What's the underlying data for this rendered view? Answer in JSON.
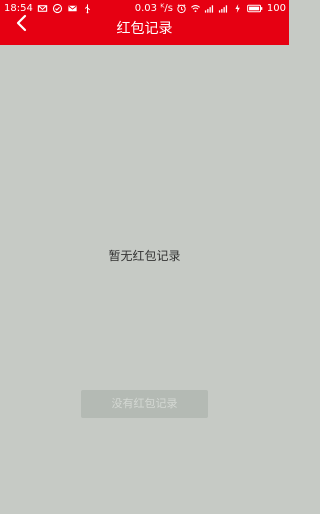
{
  "status_bar": {
    "time": "18:54",
    "network_speed": "0.03 ᴷ/s",
    "battery": "100",
    "icons_left": [
      "mail-icon",
      "check-circle-icon",
      "mail-icon",
      "usb-icon"
    ],
    "icons_right": [
      "alarm-icon",
      "wifi-icon",
      "signal-icon",
      "signal-icon",
      "charging-icon",
      "battery-icon"
    ]
  },
  "header": {
    "title": "红包记录",
    "back_icon": "chevron-left-icon",
    "background_color": "#e60012"
  },
  "empty_state": {
    "message": "暂无红包记录",
    "button_label": "没有红包记录",
    "button_enabled": false
  },
  "colors": {
    "page_background": "#c6cac5",
    "accent": "#e60012"
  }
}
